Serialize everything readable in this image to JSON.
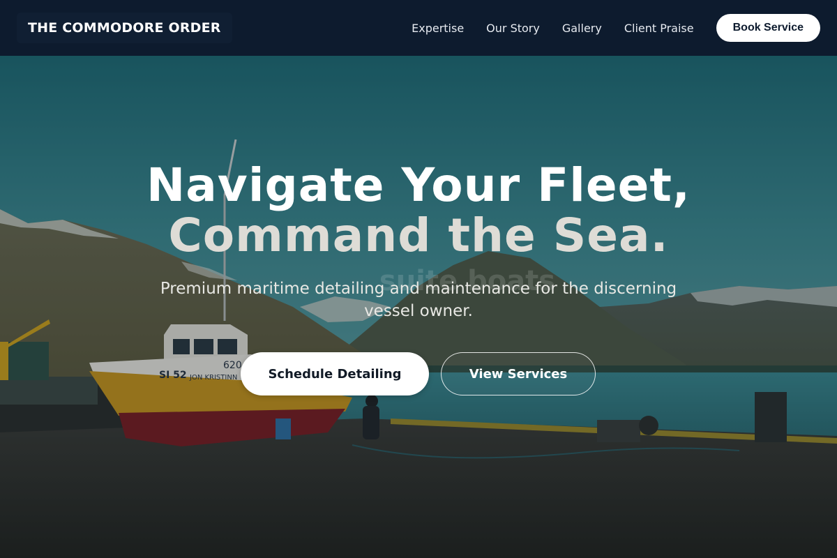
{
  "brand": {
    "name": "THE COMMODORE ORDER"
  },
  "nav": {
    "items": [
      {
        "label": "Expertise"
      },
      {
        "label": "Our Story"
      },
      {
        "label": "Gallery"
      },
      {
        "label": "Client Praise"
      }
    ],
    "cta_label": "Book Service"
  },
  "hero": {
    "headline_line1": "Navigate Your Fleet,",
    "headline_line2": "Command the Sea.",
    "ghost_text": "suite boats",
    "subheadline": "Premium maritime detailing and maintenance for the discerning vessel owner.",
    "primary_cta": "Schedule Detailing",
    "secondary_cta": "View Services",
    "boat_hull_text": "SI 52",
    "boat_name_text": "JON KRISTINN",
    "boat_number_text": "620"
  },
  "colors": {
    "header_bg": "#0d1b2e",
    "button_bg": "#ffffff",
    "button_text": "#0d1b2e",
    "sky": "#2f7b83",
    "water": "#3a7d86",
    "hull_yellow": "#c9961c",
    "hull_red": "#7a1d22"
  }
}
